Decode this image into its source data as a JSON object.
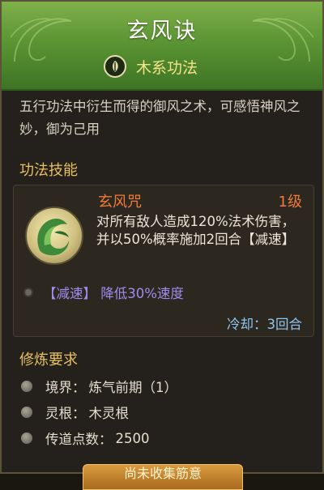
{
  "header": {
    "title": "玄风诀",
    "type_label": "木系功法"
  },
  "description": "五行功法中衍生而得的御风之术，可感悟神风之妙，御为己用",
  "skills_section": {
    "title": "功法技能",
    "skill": {
      "name": "玄风咒",
      "level": "1级",
      "description": "对所有敌人造成120%法术伤害，并以50%概率施加2回合【减速】",
      "effect": "【减速】 降低30%速度",
      "cooldown": "冷却：3回合"
    }
  },
  "requirements_section": {
    "title": "修炼要求",
    "items": [
      {
        "label": "境界：",
        "value": "炼气前期（1）"
      },
      {
        "label": "灵根：",
        "value": "木灵根"
      },
      {
        "label": "传道点数：",
        "value": "2500"
      }
    ]
  },
  "bottom_button": {
    "label": "尚未收集筋意"
  },
  "colors": {
    "header_green": "#5c9534",
    "gold_text": "#e8c062",
    "skill_orange": "#f07a3a",
    "effect_purple": "#9f8cf0",
    "cooldown_blue": "#8fc6f2"
  }
}
